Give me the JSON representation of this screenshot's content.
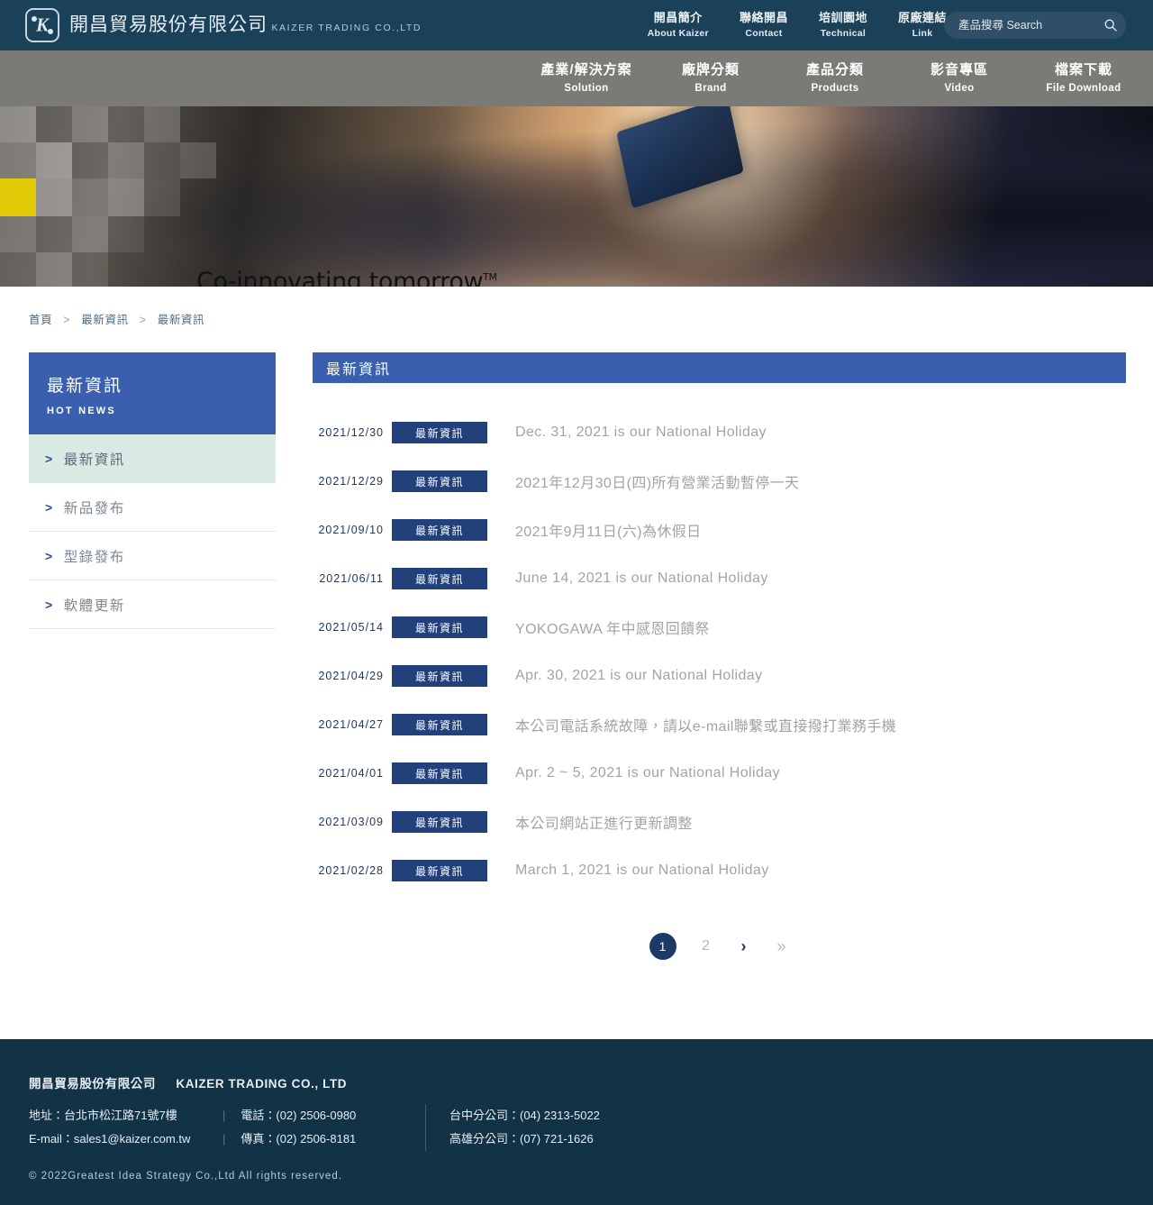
{
  "brand": {
    "name_cn": "開昌貿易股份有限公司",
    "name_en": "KAIZER TRADING CO.,LTD",
    "logo_letter": "K"
  },
  "topnav": {
    "items": [
      {
        "cn": "開昌簡介",
        "en": "About Kaizer"
      },
      {
        "cn": "聯絡開昌",
        "en": "Contact"
      },
      {
        "cn": "培訓園地",
        "en": "Technical"
      },
      {
        "cn": "原廠連結",
        "en": "Link"
      }
    ]
  },
  "search": {
    "placeholder": "產品搜尋 Search",
    "value": ""
  },
  "mainnav": {
    "items": [
      {
        "cn": "產業/解決方案",
        "en": "Solution"
      },
      {
        "cn": "廠牌分類",
        "en": "Brand"
      },
      {
        "cn": "產品分類",
        "en": "Products"
      },
      {
        "cn": "影音專區",
        "en": "Video"
      },
      {
        "cn": "檔案下載",
        "en": "File Download"
      }
    ]
  },
  "hero": {
    "tagline": "Co-innovating tomorrow",
    "trademark": "TM"
  },
  "breadcrumb": {
    "items": [
      "首頁",
      "最新資訊",
      "最新資訊"
    ],
    "separator": ">"
  },
  "sidebar": {
    "title_cn": "最新資訊",
    "title_en": "HOT NEWS",
    "chevron": ">",
    "items": [
      {
        "label": "最新資訊",
        "active": true
      },
      {
        "label": "新品發布",
        "active": false
      },
      {
        "label": "型錄發布",
        "active": false
      },
      {
        "label": "軟體更新",
        "active": false
      }
    ]
  },
  "content": {
    "heading": "最新資訊",
    "news": [
      {
        "date": "2021/12/30",
        "tag": "最新資訊",
        "title": "Dec. 31, 2021 is our National Holiday"
      },
      {
        "date": "2021/12/29",
        "tag": "最新資訊",
        "title": "2021年12月30日(四)所有營業活動暫停一天"
      },
      {
        "date": "2021/09/10",
        "tag": "最新資訊",
        "title": "2021年9月11日(六)為休假日"
      },
      {
        "date": "2021/06/11",
        "tag": "最新資訊",
        "title": "June 14, 2021 is our National Holiday"
      },
      {
        "date": "2021/05/14",
        "tag": "最新資訊",
        "title": "YOKOGAWA 年中感恩回饋祭"
      },
      {
        "date": "2021/04/29",
        "tag": "最新資訊",
        "title": "Apr. 30, 2021 is our National Holiday"
      },
      {
        "date": "2021/04/27",
        "tag": "最新資訊",
        "title": "本公司電話系統故障，請以e-mail聯繫或直接撥打業務手機"
      },
      {
        "date": "2021/04/01",
        "tag": "最新資訊",
        "title": "Apr. 2 ~ 5, 2021 is our National Holiday"
      },
      {
        "date": "2021/03/09",
        "tag": "最新資訊",
        "title": "本公司網站正進行更新調整"
      },
      {
        "date": "2021/02/28",
        "tag": "最新資訊",
        "title": "March 1, 2021 is our National Holiday"
      }
    ]
  },
  "pagination": {
    "current": "1",
    "pages": [
      "1",
      "2"
    ],
    "next": "›",
    "last": "»"
  },
  "footer": {
    "company_cn": "開昌貿易股份有限公司",
    "company_en": "KAIZER TRADING CO., LTD",
    "address": "地址：台北市松江路71號7樓",
    "phone": "電話：(02) 2506-0980",
    "email": "E-mail：sales1@kaizer.com.tw",
    "fax": "傳真：(02) 2506-8181",
    "branch_taichung": "台中分公司：(04) 2313-5022",
    "branch_kaohsiung": "高雄分公司：(07) 721-1626",
    "copyright": "© 2022Greatest Idea Strategy Co.,Ltd All rights reserved.",
    "divider": "|"
  },
  "colors": {
    "topbar": "#1b4159",
    "mainnav": "#7a7a76",
    "accent_blue": "#3a5fae",
    "tag_navy": "#22407a",
    "active_green": "#d9eae5",
    "footer": "#123246",
    "hero_yellow": "#ffe400"
  }
}
